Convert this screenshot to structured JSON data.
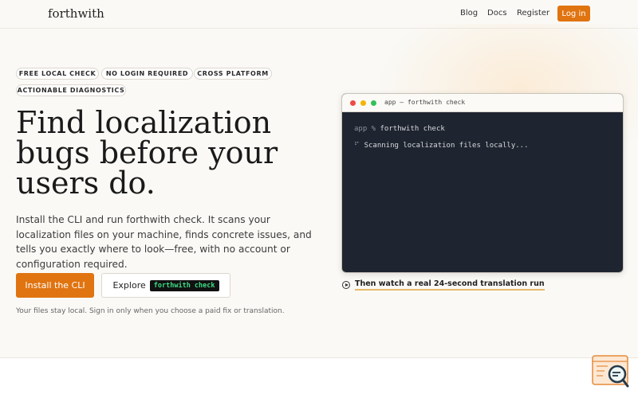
{
  "header": {
    "logo": "forthwith",
    "nav": {
      "blog": "Blog",
      "docs": "Docs",
      "register": "Register",
      "login": "Log in"
    }
  },
  "hero": {
    "badges": [
      "FREE LOCAL CHECK",
      "NO LOGIN REQUIRED",
      "CROSS PLATFORM",
      "ACTIONABLE DIAGNOSTICS"
    ],
    "title_line1": "Find localization",
    "title_line2": "bugs before your",
    "title_line3": "users do.",
    "description": "Install the CLI and run forthwith check. It scans your localization files on your machine, finds concrete issues, and tells you exactly where to look—free, with no account or configuration required.",
    "cta_primary": "Install the CLI",
    "cta_secondary_prefix": "Explore",
    "cta_secondary_code": "forthwith check",
    "note": "Your files stay local. Sign in only when you choose a paid fix or translation."
  },
  "terminal": {
    "title": "app — forthwith check",
    "prompt": "app %",
    "command": "forthwith check",
    "spinner": "⠋",
    "status": "Scanning localization files locally...",
    "dot_colors": [
      "#ef4a45",
      "#f4b400",
      "#34c05a"
    ]
  },
  "watch_link": "Then watch a real 24-second translation run",
  "icons": {
    "play": "play-circle-icon",
    "corner": "search-chat-widget-icon"
  }
}
